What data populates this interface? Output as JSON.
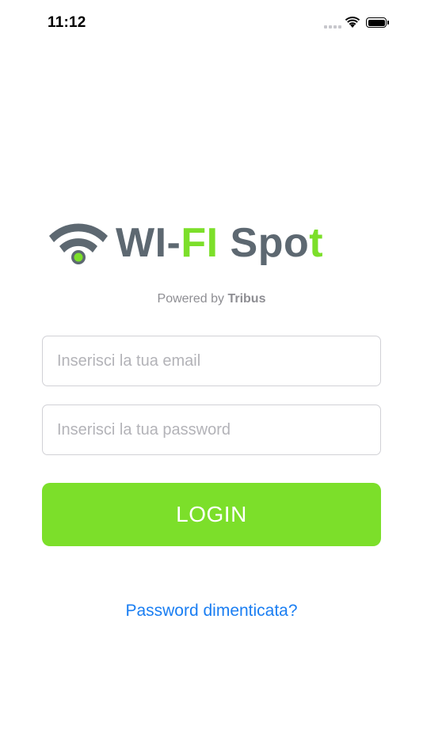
{
  "status_bar": {
    "time": "11:12",
    "battery_level": 1.0
  },
  "logo": {
    "part1": "WI-",
    "part2": "FI",
    "part3": " Spot",
    "gray_color": "#5d6871",
    "green_color": "#7cdf2a"
  },
  "powered": {
    "prefix": "Powered by",
    "brand": "Tribus"
  },
  "form": {
    "email_placeholder": "Inserisci la tua email",
    "email_value": "",
    "password_placeholder": "Inserisci la tua password",
    "password_value": ""
  },
  "login": {
    "label": "LOGIN",
    "color": "#7cdf2a"
  },
  "forgot": {
    "label": "Password dimenticata?",
    "color": "#1a7ef2"
  }
}
